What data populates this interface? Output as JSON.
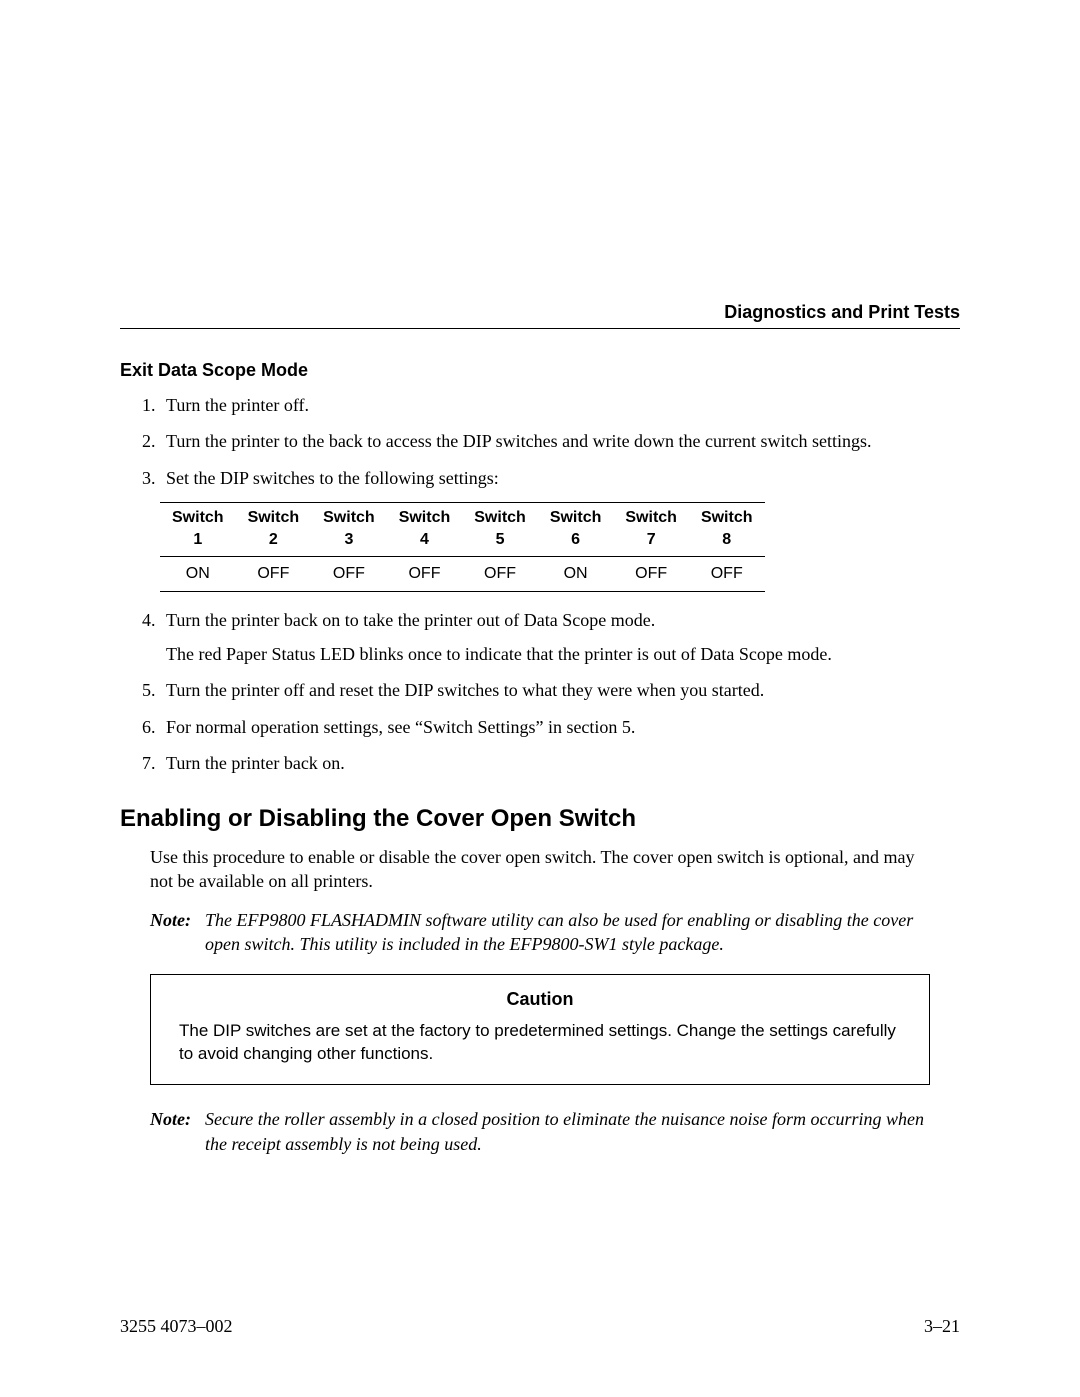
{
  "header": {
    "running_title": "Diagnostics and Print Tests"
  },
  "exit_mode": {
    "heading": "Exit Data Scope Mode",
    "steps_before_table": [
      "Turn the printer off.",
      "Turn the printer to the back to access the DIP switches and write down the current switch settings.",
      "Set the DIP switches to the following settings:"
    ],
    "table": {
      "header_word": "Switch",
      "cols": [
        "1",
        "2",
        "3",
        "4",
        "5",
        "6",
        "7",
        "8"
      ],
      "row": [
        "ON",
        "OFF",
        "OFF",
        "OFF",
        "OFF",
        "ON",
        "OFF",
        "OFF"
      ]
    },
    "step4": "Turn the printer back on to take the printer out of Data Scope mode.",
    "step4_follow": "The red Paper Status LED blinks once to indicate that the printer is out of Data Scope mode.",
    "steps_after": [
      "Turn the printer off and reset the DIP switches to what they were when you started.",
      "For normal operation settings, see “Switch Settings” in section 5.",
      "Turn the printer back on."
    ]
  },
  "cover_switch": {
    "heading": "Enabling or Disabling the Cover Open Switch",
    "intro": "Use this procedure to enable or disable the cover open switch. The cover open switch is optional, and may not be available on all printers.",
    "note1_label": "Note:",
    "note1": "The EFP9800 FLASHADMIN software utility can also be used for enabling or disabling the cover open switch.  This utility is included in the EFP9800-SW1 style package.",
    "caution_title": "Caution",
    "caution_body": "The DIP switches are set at the factory to predetermined settings. Change the settings carefully to avoid changing other functions.",
    "note2_label": "Note:",
    "note2": "Secure the roller assembly in a closed position to eliminate the nuisance noise form occurring when the receipt assembly is not being used."
  },
  "footer": {
    "left": "3255 4073–002",
    "right": "3–21"
  }
}
